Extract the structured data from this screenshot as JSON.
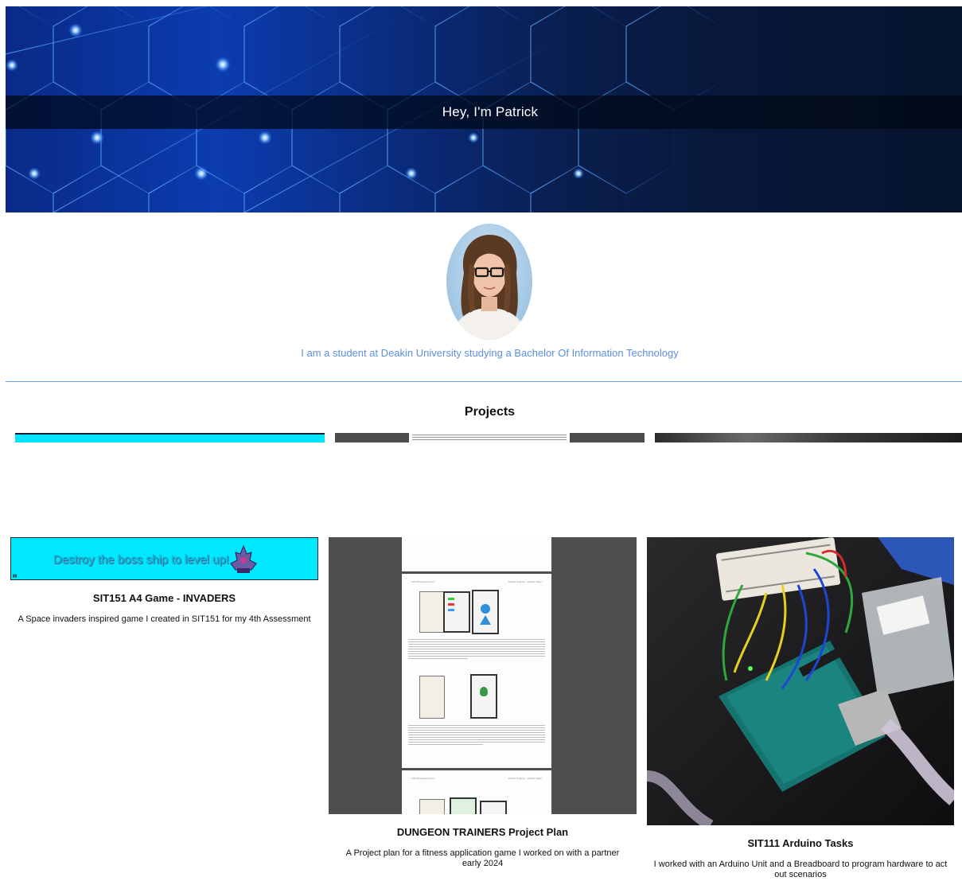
{
  "hero": {
    "title": "Hey, I'm Patrick"
  },
  "profile": {
    "bio": "I am a student at Deakin University studying a Bachelor Of Information Technology"
  },
  "projects": {
    "heading": "Projects",
    "items": [
      {
        "title": "SIT151 A4 Game - INVADERS",
        "description": "A Space invaders inspired game I created in SIT151 for my 4th Assessment",
        "thumb_text": "Destroy the boss ship to level up!"
      },
      {
        "title": "DUNGEON TRAINERS Project Plan",
        "description": "A Project plan for a fitness application game I worked on with a partner early 2024",
        "thumb_header_left": "SIT216 Assessment 3",
        "thumb_header_right": "Patrick Cognion, Lachlan Slater"
      },
      {
        "title": "SIT111 Arduino Tasks",
        "description": "I worked with an Arduino Unit and a Breadboard to program hardware to act out scenarios"
      }
    ]
  },
  "colors": {
    "hero_blue": "#0b3cb0",
    "bio_text": "#5b8fe0",
    "divider": "#6f9fe8",
    "game_thumb_cyan": "#00e8ff"
  }
}
